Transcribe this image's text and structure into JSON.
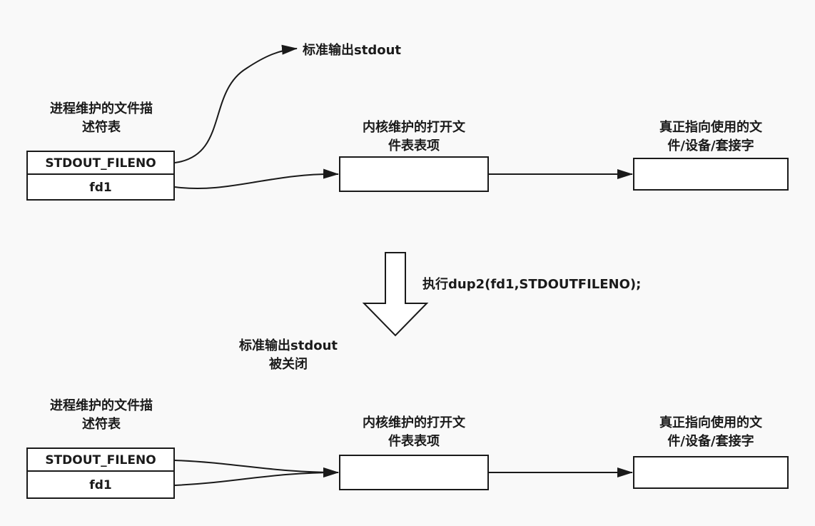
{
  "top": {
    "stdout_label": "标准输出stdout",
    "process_table_title": [
      "进程维护的文件描",
      "述符表"
    ],
    "fd_rows": [
      "STDOUT_FILENO",
      "fd1"
    ],
    "kernel_table_title": [
      "内核维护的打开文",
      "件表表项"
    ],
    "target_title": [
      "真正指向使用的文",
      "件/设备/套接字"
    ]
  },
  "transition": {
    "operation_label": "执行dup2(fd1,STDOUTFILENO);",
    "note": [
      "标准输出stdout",
      "被关闭"
    ]
  },
  "bottom": {
    "process_table_title": [
      "进程维护的文件描",
      "述符表"
    ],
    "fd_rows": [
      "STDOUT_FILENO",
      "fd1"
    ],
    "kernel_table_title": [
      "内核维护的打开文",
      "件表表项"
    ],
    "target_title": [
      "真正指向使用的文",
      "件/设备/套接字"
    ]
  },
  "colors": {
    "background": "#f9f9f9",
    "stroke": "#1a1a1a",
    "box_fill": "#ffffff"
  }
}
